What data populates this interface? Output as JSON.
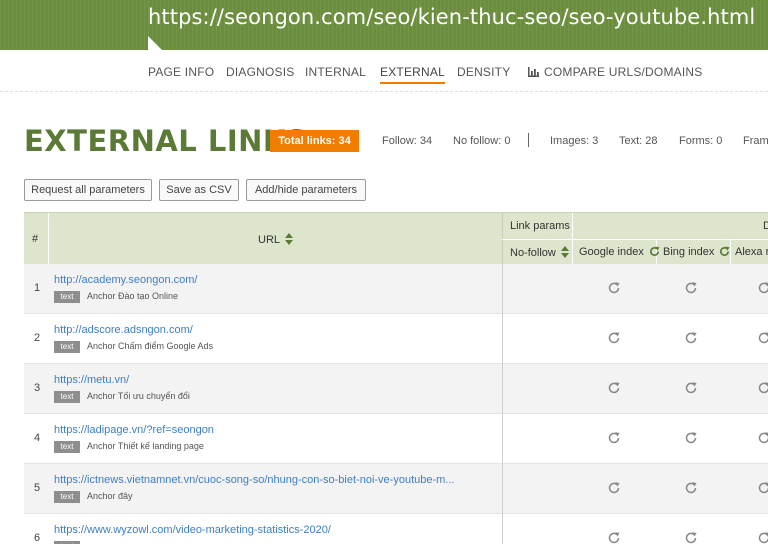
{
  "banner": {
    "url": "https://seongon.com/seo/kien-thuc-seo/seo-youtube.html",
    "color": "#6b8e3c"
  },
  "nav": {
    "items": [
      {
        "label": "PAGE INFO"
      },
      {
        "label": "DIAGNOSIS"
      },
      {
        "label": "INTERNAL"
      },
      {
        "label": "EXTERNAL"
      },
      {
        "label": "DENSITY"
      },
      {
        "label": "COMPARE URLS/DOMAINS"
      }
    ],
    "active": "EXTERNAL"
  },
  "header": {
    "title": "EXTERNAL LINKS",
    "total_label": "Total links:  34",
    "stats": {
      "follow": "Follow: 34",
      "nofollow": "No follow: 0",
      "images": "Images: 3",
      "text": "Text: 28",
      "forms": "Forms: 0",
      "frames": "Fram"
    }
  },
  "toolbar": {
    "request_label": "Request all parameters",
    "csv_label": "Save as CSV",
    "addhide_label": "Add/hide parameters"
  },
  "table": {
    "col_num": "#",
    "col_url": "URL",
    "group_link_params": "Link params",
    "group_d": "D",
    "col_nofollow": "No-follow",
    "col_google": "Google index",
    "col_bing": "Bing index",
    "col_alexa": "Alexa ra",
    "rows": [
      {
        "num": "1",
        "url": "http://academy.seongon.com/",
        "tag": "text",
        "anchor": "Anchor Đào tạo Online"
      },
      {
        "num": "2",
        "url": "http://adscore.adsngon.com/",
        "tag": "text",
        "anchor": "Anchor Chấm điểm Google Ads"
      },
      {
        "num": "3",
        "url": "https://metu.vn/",
        "tag": "text",
        "anchor": "Anchor Tối ưu chuyển đổi"
      },
      {
        "num": "4",
        "url": "https://ladipage.vn/?ref=seongon",
        "tag": "text",
        "anchor": "Anchor Thiết kế landing page"
      },
      {
        "num": "5",
        "url": "https://ictnews.vietnamnet.vn/cuoc-song-so/nhung-con-so-biet-noi-ve-youtube-m...",
        "tag": "text",
        "anchor": "Anchor đây"
      },
      {
        "num": "6",
        "url": "https://www.wyzowl.com/video-marketing-statistics-2020/",
        "tag": "text",
        "anchor": ""
      }
    ]
  },
  "colors": {
    "accent": "#f07d00",
    "title_green": "#5a7a35",
    "header_bg": "#dde5cd",
    "link": "#3e7fc1"
  }
}
